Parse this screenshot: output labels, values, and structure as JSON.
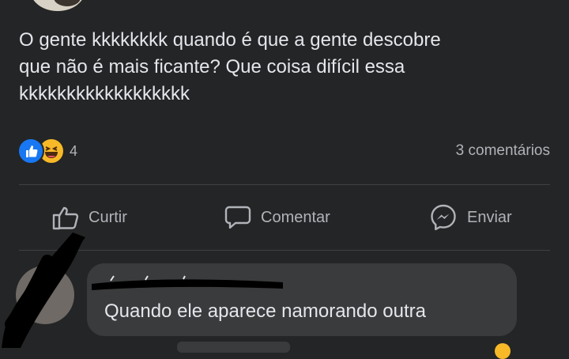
{
  "post": {
    "text_lines": [
      "O gente kkkkkkkk quando é que a gente descobre",
      "que não é mais ficante? Que coisa difícil essa",
      "kkkkkkkkkkkkkkkkkk"
    ],
    "reactions": {
      "icons": [
        "like-icon",
        "haha-icon"
      ],
      "count": "4"
    },
    "comments_count": "3 comentários"
  },
  "actions": {
    "like_label": "Curtir",
    "comment_label": "Comentar",
    "send_label": "Enviar"
  },
  "comment": {
    "author": "",
    "text": "Quando ele aparece namorando outra"
  },
  "colors": {
    "background": "#242526",
    "text": "#e4e6eb",
    "muted": "#b0b3b8",
    "bubble": "#3a3b3c",
    "like_blue": "#1877f2",
    "haha_yellow": "#f7b928"
  }
}
